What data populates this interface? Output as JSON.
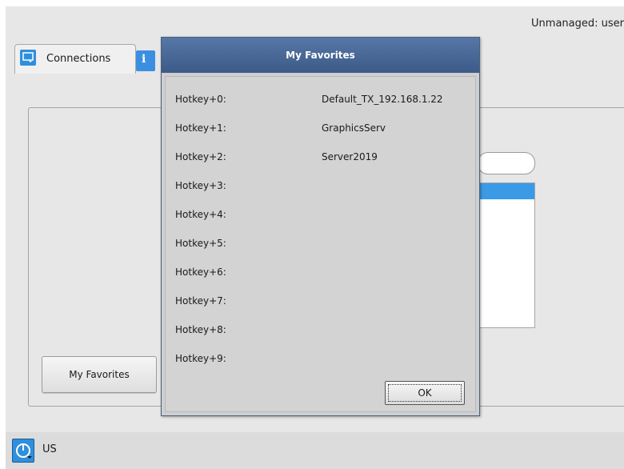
{
  "status": {
    "managed_text": "Unmanaged: user"
  },
  "tabs": {
    "connections_label": "Connections",
    "icons": [
      "connections-icon",
      "info-icon"
    ]
  },
  "info_tab": {
    "glyph": "i"
  },
  "panel": {
    "favorites_button_label": "My Favorites"
  },
  "bottom_bar": {
    "locale": "US",
    "icon": "power-icon"
  },
  "dialog": {
    "title": "My Favorites",
    "hotkeys": [
      {
        "label": "Hotkey+0:",
        "value": "Default_TX_192.168.1.22"
      },
      {
        "label": "Hotkey+1:",
        "value": "GraphicsServ"
      },
      {
        "label": "Hotkey+2:",
        "value": "Server2019"
      },
      {
        "label": "Hotkey+3:",
        "value": ""
      },
      {
        "label": "Hotkey+4:",
        "value": ""
      },
      {
        "label": "Hotkey+5:",
        "value": ""
      },
      {
        "label": "Hotkey+6:",
        "value": ""
      },
      {
        "label": "Hotkey+7:",
        "value": ""
      },
      {
        "label": "Hotkey+8:",
        "value": ""
      },
      {
        "label": "Hotkey+9:",
        "value": ""
      }
    ],
    "ok_label": "OK"
  },
  "colors": {
    "accent": "#2f8fdd",
    "title_bar": "#4a6a99",
    "selection": "#3a9ae6"
  }
}
